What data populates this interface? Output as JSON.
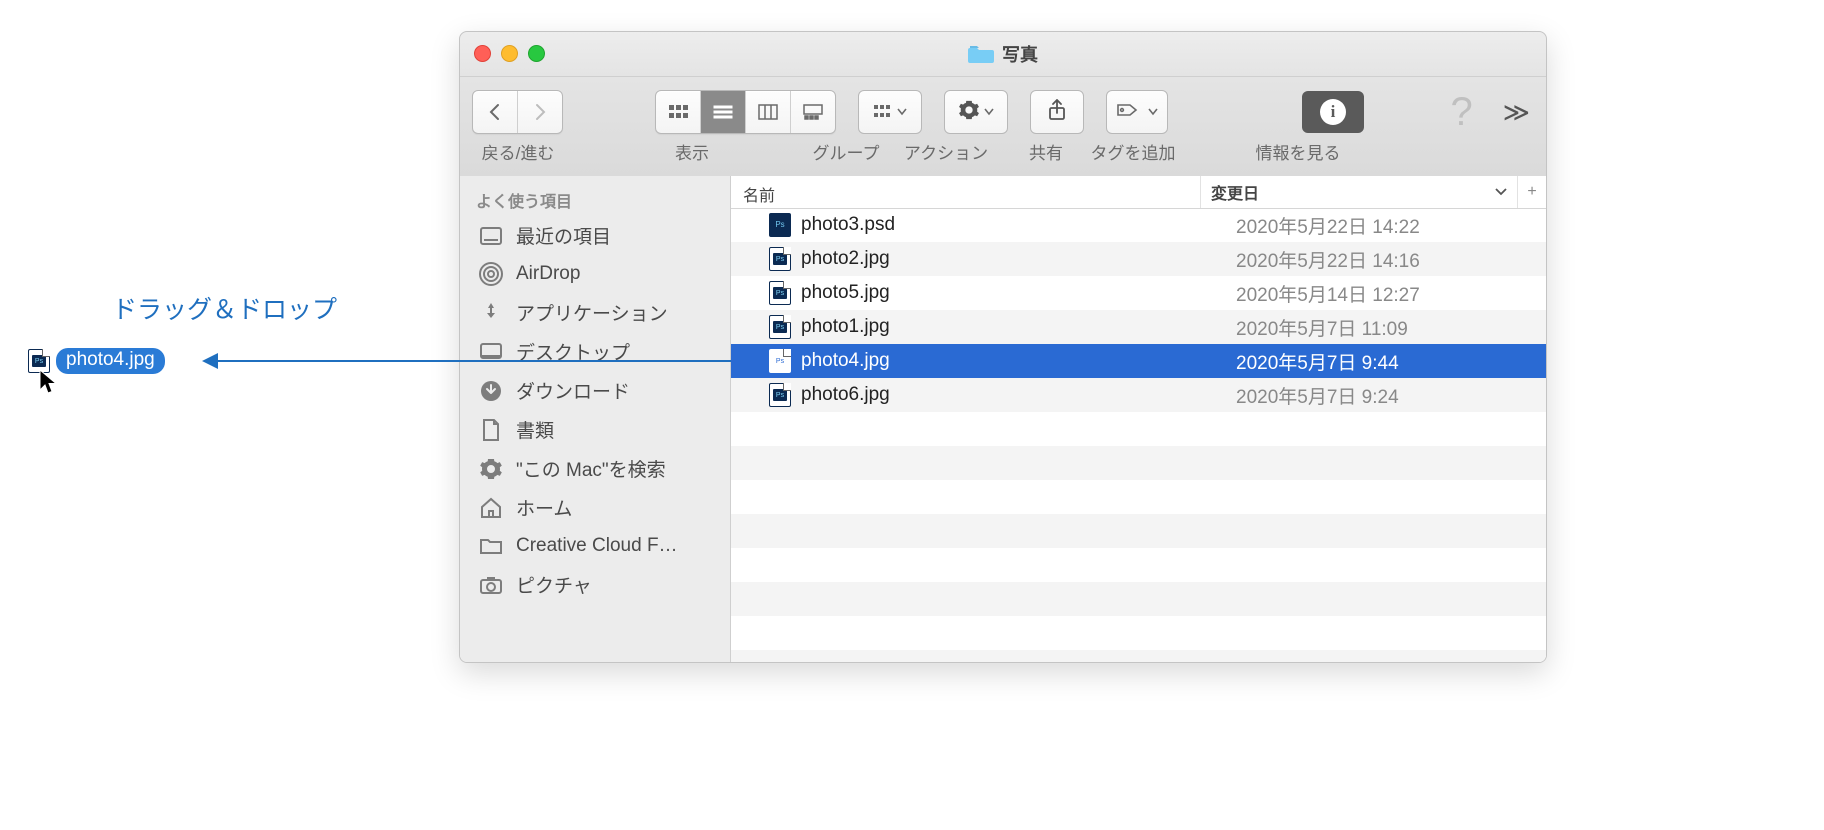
{
  "window": {
    "title": "写真"
  },
  "toolbar": {
    "back_fwd_label": "戻る/進む",
    "view_label": "表示",
    "group_label": "グループ",
    "action_label": "アクション",
    "share_label": "共有",
    "tags_label": "タグを追加",
    "info_label": "情報を見る"
  },
  "sidebar": {
    "section": "よく使う項目",
    "items": [
      {
        "label": "最近の項目"
      },
      {
        "label": "AirDrop"
      },
      {
        "label": "アプリケーション"
      },
      {
        "label": "デスクトップ"
      },
      {
        "label": "ダウンロード"
      },
      {
        "label": "書類"
      },
      {
        "label": "\"この Mac\"を検索"
      },
      {
        "label": "ホーム"
      },
      {
        "label": "Creative Cloud F…"
      },
      {
        "label": "ピクチャ"
      }
    ]
  },
  "list": {
    "col_name": "名前",
    "col_date": "変更日",
    "rows": [
      {
        "name": "photo3.psd",
        "date": "2020年5月22日 14:22",
        "kind": "psd",
        "selected": false
      },
      {
        "name": "photo2.jpg",
        "date": "2020年5月22日 14:16",
        "kind": "ps",
        "selected": false
      },
      {
        "name": "photo5.jpg",
        "date": "2020年5月14日 12:27",
        "kind": "ps",
        "selected": false
      },
      {
        "name": "photo1.jpg",
        "date": "2020年5月7日 11:09",
        "kind": "ps",
        "selected": false
      },
      {
        "name": "photo4.jpg",
        "date": "2020年5月7日 9:44",
        "kind": "ps",
        "selected": true
      },
      {
        "name": "photo6.jpg",
        "date": "2020年5月7日 9:24",
        "kind": "ps",
        "selected": false
      }
    ]
  },
  "drag": {
    "filename": "photo4.jpg"
  },
  "annotation": {
    "text": "ドラッグ＆ドロップ"
  }
}
